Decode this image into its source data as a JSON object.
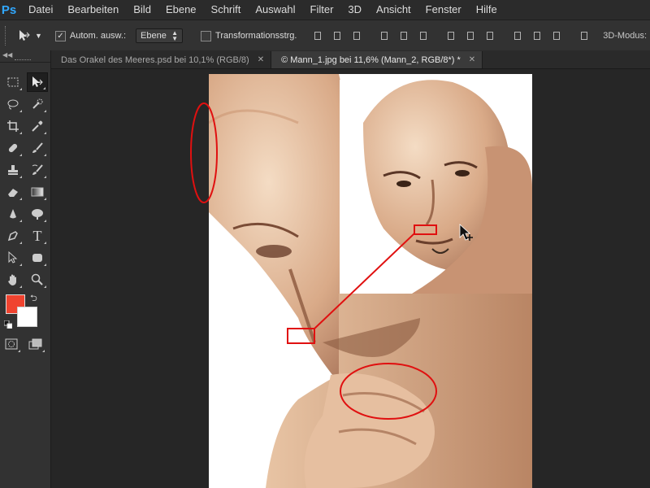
{
  "app": {
    "logo": "Ps"
  },
  "menu": [
    "Datei",
    "Bearbeiten",
    "Bild",
    "Ebene",
    "Schrift",
    "Auswahl",
    "Filter",
    "3D",
    "Ansicht",
    "Fenster",
    "Hilfe"
  ],
  "options": {
    "auto_select_label": "Autom. ausw.:",
    "auto_select_checked": true,
    "auto_select_target": "Ebene",
    "transform_controls_label": "Transformationsstrg.",
    "transform_controls_checked": false,
    "mode_label": "3D-Modus:"
  },
  "tabs": [
    {
      "label": "Das Orakel des Meeres.psd bei 10,1% (RGB/8)",
      "active": false
    },
    {
      "label": "© Mann_1.jpg bei 11,6% (Mann_2, RGB/8*) *",
      "active": true
    }
  ],
  "colors": {
    "foreground": "#f0432f",
    "background": "#ffffff",
    "annotation": "#e01010"
  },
  "icons": {
    "tools": [
      "marquee-icon",
      "move-icon",
      "lasso-icon",
      "quick-selection-icon",
      "crop-icon",
      "eyedropper-icon",
      "healing-brush-icon",
      "brush-icon",
      "clone-stamp-icon",
      "history-brush-icon",
      "eraser-icon",
      "gradient-icon",
      "blur-icon",
      "dodge-icon",
      "pen-icon",
      "type-icon",
      "path-selection-icon",
      "shape-icon",
      "hand-icon",
      "zoom-icon"
    ]
  }
}
